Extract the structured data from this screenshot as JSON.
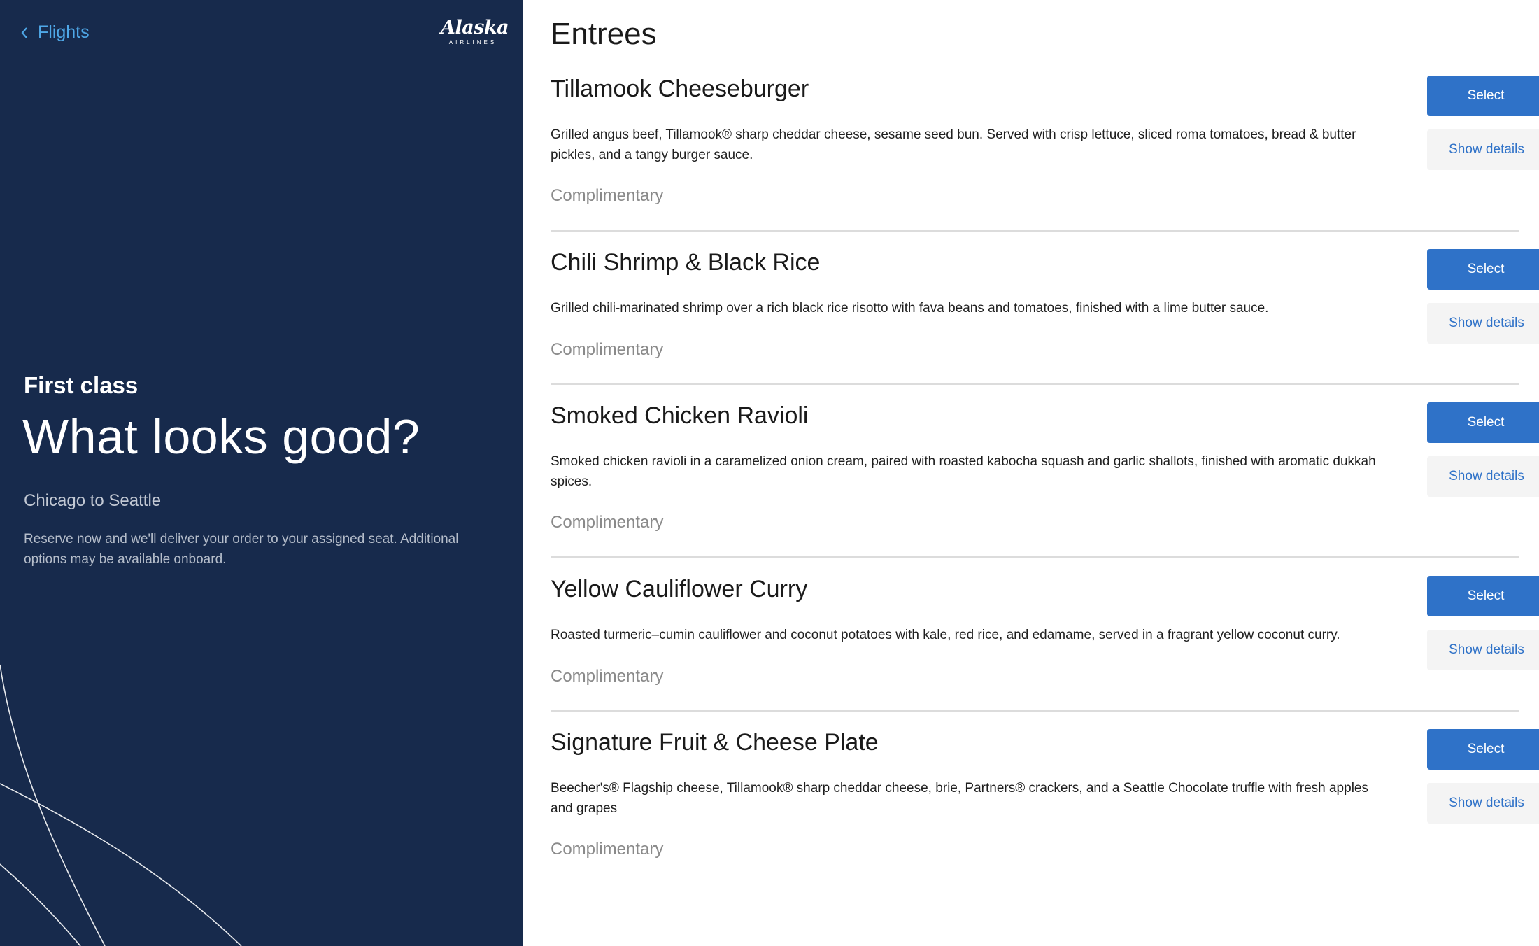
{
  "nav": {
    "back_label": "Flights",
    "logo_text": "Alaska",
    "logo_subtext": "AIRLINES"
  },
  "hero": {
    "class_label": "First class",
    "headline": "What looks good?",
    "route": "Chicago to Seattle",
    "info": "Reserve now and we'll deliver your order to your assigned seat. Additional options may be available onboard."
  },
  "menu": {
    "section_title": "Entrees",
    "select_label": "Select",
    "details_label": "Show details",
    "items": [
      {
        "name": "Tillamook Cheeseburger",
        "description": "Grilled angus beef, Tillamook® sharp cheddar cheese, sesame seed bun. Served with crisp lettuce, sliced roma tomatoes, bread & butter pickles, and a tangy burger sauce.",
        "price": "Complimentary"
      },
      {
        "name": "Chili Shrimp & Black Rice",
        "description": "Grilled chili-marinated shrimp over a rich black rice risotto with fava beans and tomatoes, finished with a lime butter sauce.",
        "price": "Complimentary"
      },
      {
        "name": "Smoked Chicken Ravioli",
        "description": "Smoked chicken ravioli in a caramelized onion cream, paired with roasted kabocha squash and garlic shallots, finished with aromatic dukkah spices.",
        "price": "Complimentary"
      },
      {
        "name": "Yellow Cauliflower Curry",
        "description": "Roasted turmeric–cumin cauliflower and coconut potatoes with kale, red rice, and edamame, served in a fragrant yellow coconut curry.",
        "price": "Complimentary"
      },
      {
        "name": "Signature Fruit & Cheese Plate",
        "description": "Beecher's® Flagship cheese, Tillamook® sharp cheddar cheese, brie, Partners® crackers, and a Seattle Chocolate truffle with fresh apples and grapes",
        "price": "Complimentary"
      }
    ]
  },
  "colors": {
    "sidebar_bg": "#172a4c",
    "link": "#4fa8e8",
    "primary_button": "#2f72c8",
    "secondary_button_bg": "#f4f4f4"
  }
}
